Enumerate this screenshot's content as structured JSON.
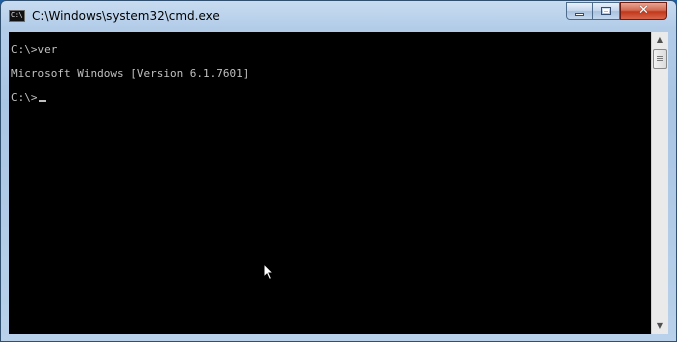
{
  "window": {
    "title": "C:\\Windows\\system32\\cmd.exe",
    "icon": "cmd-icon",
    "icon_text": "C:\\",
    "controls": {
      "minimize": "minimize-icon",
      "maximize": "maximize-icon",
      "close_glyph": "✕"
    }
  },
  "console": {
    "lines": [
      "C:\\>ver",
      "Microsoft Windows [Version 6.1.7601]",
      "C:\\>"
    ],
    "text_color": "#c0c0c0",
    "background": "#000000"
  },
  "scrollbar": {
    "up_glyph": "▲",
    "down_glyph": "▼"
  }
}
